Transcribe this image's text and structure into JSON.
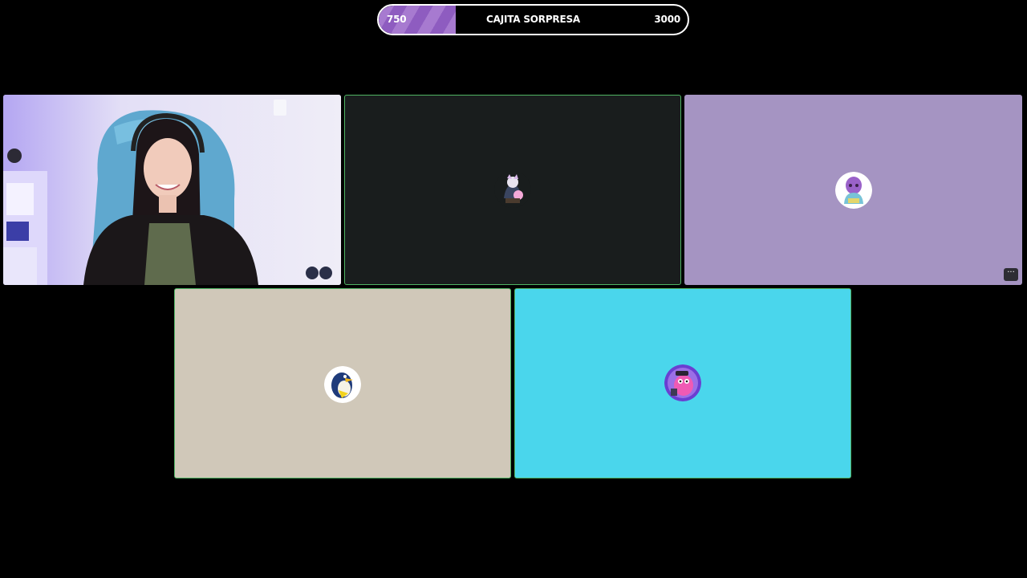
{
  "goal": {
    "start": "750",
    "title": "CAJITA SORPRESA",
    "end": "3000",
    "progress": 0.25,
    "fill_color": "#a77ad0"
  },
  "tiles": [
    {
      "kind": "camera",
      "label": "webcam-participant"
    },
    {
      "kind": "avatar",
      "bg": "#191d1d",
      "avatar": "cat-figure-avatar",
      "active": true
    },
    {
      "kind": "avatar",
      "bg": "#a594c2",
      "avatar": "purple-character-avatar",
      "more_icon": "ellipsis-icon",
      "more_label": "···"
    },
    {
      "kind": "avatar",
      "bg": "#d0c8b9",
      "avatar": "penguin-avatar",
      "active": true
    },
    {
      "kind": "avatar",
      "bg": "#4ad6ec",
      "avatar": "pink-creature-avatar",
      "active": true
    }
  ],
  "colors": {
    "active_border": "#4fb463",
    "page_bg": "#000000"
  }
}
